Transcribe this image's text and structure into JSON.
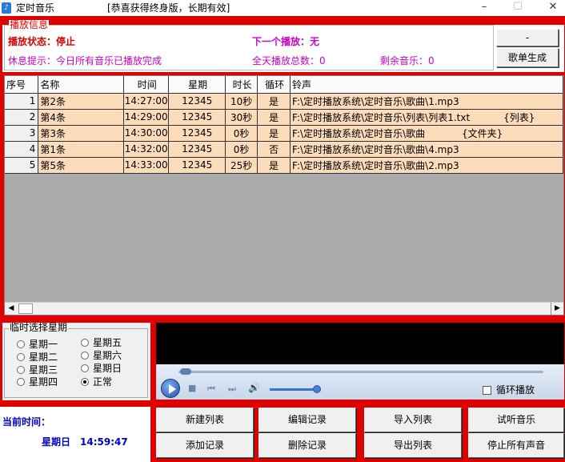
{
  "window": {
    "icon": "music-app-icon",
    "title": "定时音乐",
    "subtitle": "[恭喜获得终身版，长期有效]",
    "minimize": "–",
    "maximize": "☐",
    "close": "✕"
  },
  "info": {
    "legend": "播放信息",
    "status_label": "播放状态：停止",
    "next_label": "下一个播放：无",
    "rest_tip": "休息提示：今日所有音乐已播放完成",
    "total_plays": "全天播放总数：0",
    "remaining": "剩余音乐：0",
    "btn_dash": "-",
    "btn_generate": "歌单生成"
  },
  "table": {
    "headers": [
      "序号",
      "名称",
      "时间",
      "星期",
      "时长",
      "循环",
      "铃声"
    ],
    "rows": [
      {
        "idx": "1",
        "name": "第2条",
        "time": "14:27:00",
        "week": "12345",
        "dur": "10秒",
        "loop": "是",
        "path": "F:\\定时播放系统\\定时音乐\\歌曲\\1.mp3"
      },
      {
        "idx": "2",
        "name": "第4条",
        "time": "14:29:00",
        "week": "12345",
        "dur": "30秒",
        "loop": "是",
        "path": "F:\\定时播放系统\\定时音乐\\列表\\列表1.txt           {列表}"
      },
      {
        "idx": "3",
        "name": "第3条",
        "time": "14:30:00",
        "week": "12345",
        "dur": "0秒",
        "loop": "是",
        "path": "F:\\定时播放系统\\定时音乐\\歌曲            {文件夹}"
      },
      {
        "idx": "4",
        "name": "第1条",
        "time": "14:32:00",
        "week": "12345",
        "dur": "0秒",
        "loop": "否",
        "path": "F:\\定时播放系统\\定时音乐\\歌曲\\4.mp3"
      },
      {
        "idx": "5",
        "name": "第5条",
        "time": "14:33:00",
        "week": "12345",
        "dur": "25秒",
        "loop": "是",
        "path": "F:\\定时播放系统\\定时音乐\\歌曲\\2.mp3"
      }
    ],
    "scroll_left": "◀",
    "scroll_right": "▶"
  },
  "week": {
    "legend": "临时选择星期",
    "options": [
      "星期一",
      "星期二",
      "星期三",
      "星期四",
      "星期五",
      "星期六",
      "星期日",
      "正常"
    ],
    "selected": "正常"
  },
  "player": {
    "prev_icon": "skip-back-icon",
    "next_icon": "skip-forward-icon",
    "stop_glyph": "■",
    "prev_glyph": "⏮",
    "next_glyph": "⏭",
    "vol_glyph": "🔊",
    "loop_label": "循环播放",
    "volume_level": 0.9,
    "seek_position": 0.0
  },
  "clock": {
    "label": "当前时间：",
    "day": "星期日",
    "time": "14:59:47"
  },
  "actions": {
    "new_list": "新建列表",
    "add_record": "添加记录",
    "edit_record": "编辑记录",
    "delete_record": "删除记录",
    "import_list": "导入列表",
    "export_list": "导出列表",
    "preview_music": "试听音乐",
    "stop_all": "停止所有声音"
  },
  "colors": {
    "background_red": "#e00000",
    "row_peach": "#fddcbc",
    "status_red": "#e00000",
    "info_magenta": "#cc00cc",
    "clock_blue": "#0000cc"
  }
}
